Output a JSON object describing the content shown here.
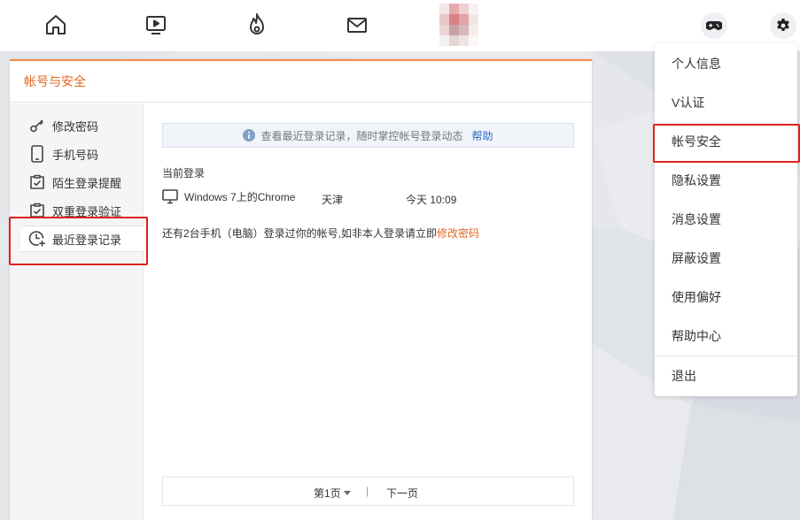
{
  "colors": {
    "accent": "#e0671f",
    "highlight_box": "#e02020",
    "link": "#2f6dc4"
  },
  "topbar": {
    "icons": [
      "home-icon",
      "tv-icon",
      "flame-icon",
      "mail-icon",
      "game-controller-icon",
      "gear-icon"
    ]
  },
  "panel": {
    "title": "帐号与安全",
    "nav": [
      {
        "label": "修改密码",
        "icon": "key-icon"
      },
      {
        "label": "手机号码",
        "icon": "phone-icon"
      },
      {
        "label": "陌生登录提醒",
        "icon": "clipboard-check-icon"
      },
      {
        "label": "双重登录验证",
        "icon": "clipboard-check-icon"
      },
      {
        "label": "最近登录记录",
        "icon": "clock-plus-icon",
        "active": true
      }
    ],
    "tip": {
      "text": "查看最近登录记录，随时掌控帐号登录动态",
      "help": "帮助"
    },
    "current_label": "当前登录",
    "current_login": {
      "device": "Windows 7上的Chrome",
      "city": "天津",
      "time": "今天 10:09"
    },
    "note": {
      "text": "还有2台手机（电脑）登录过你的帐号,如非本人登录请立即",
      "link": "修改密码"
    },
    "pager": {
      "page": "第1页",
      "separator": "|",
      "next": "下一页"
    }
  },
  "menu": {
    "items": [
      "个人信息",
      "V认证",
      "帐号安全",
      "隐私设置",
      "消息设置",
      "屏蔽设置",
      "使用偏好",
      "帮助中心",
      "退出"
    ]
  }
}
